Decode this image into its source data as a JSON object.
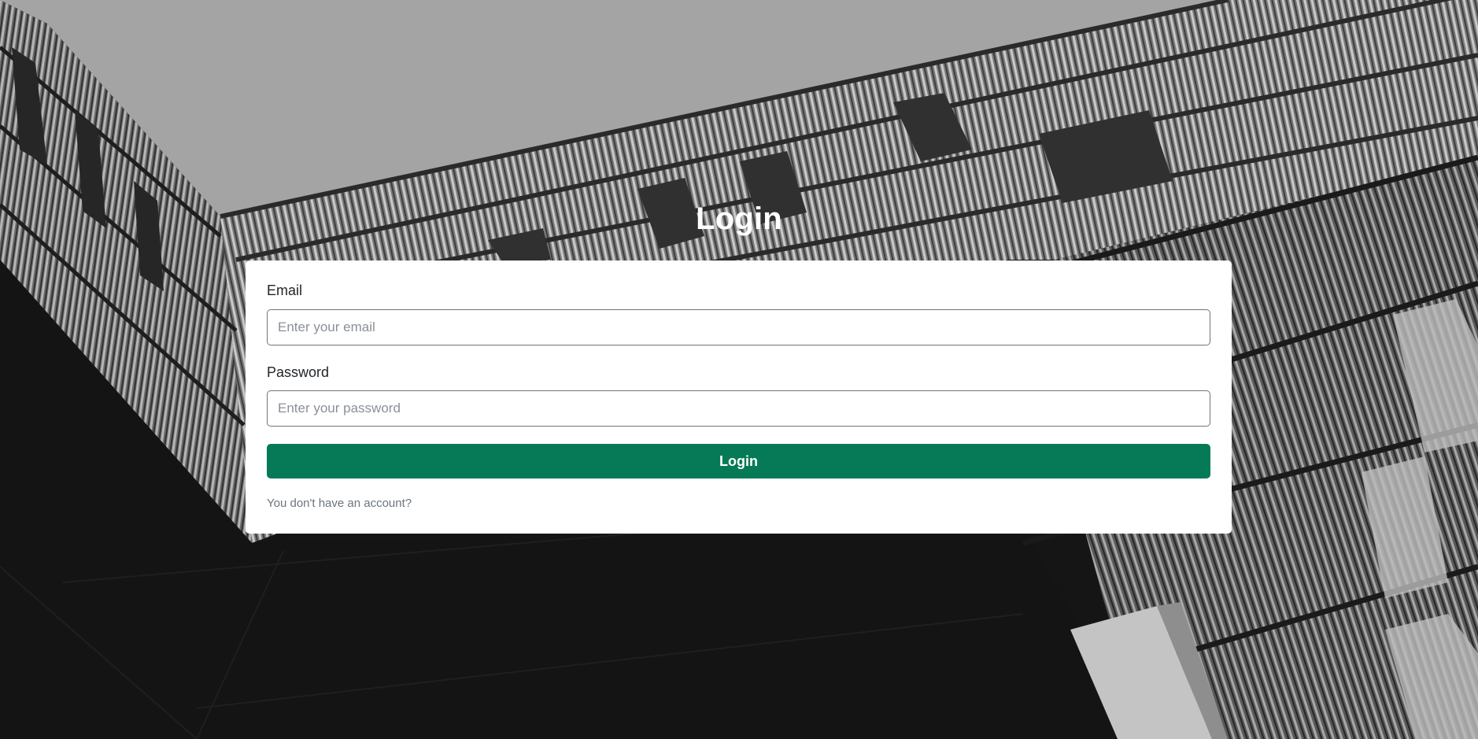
{
  "page": {
    "title": "Login"
  },
  "form": {
    "email_label": "Email",
    "email_placeholder": "Enter your email",
    "email_value": "",
    "password_label": "Password",
    "password_placeholder": "Enter your password",
    "password_value": "",
    "submit_label": "Login",
    "signup_link": "You don't have an account?"
  },
  "colors": {
    "primary_button": "#067a56",
    "card_background": "#ffffff",
    "title_text": "#ffffff",
    "muted_text": "#6c757d"
  },
  "background": {
    "icon": "building-facade-photo",
    "tone": "grayscale"
  }
}
